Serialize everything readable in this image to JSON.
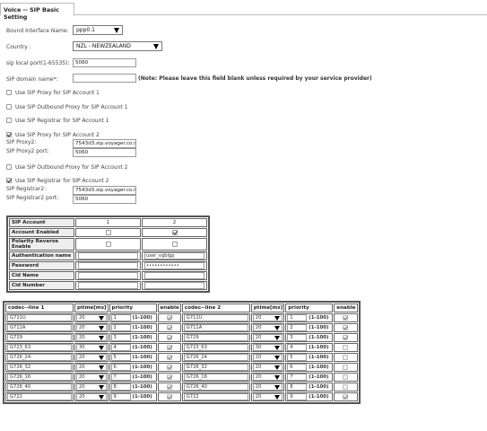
{
  "tab": {
    "label": "Voice -- SIP Basic Setting"
  },
  "form": {
    "bound_interface": {
      "label": "Bound Interface Name:",
      "value": "ppp0.1"
    },
    "country": {
      "label": "Country :",
      "value": "NZL - NEWZEALAND"
    },
    "sip_local_port": {
      "label": "sip local port(1-65535):",
      "value": "5060"
    },
    "sip_domain": {
      "label": "SIP domain name*:",
      "value": "",
      "note": "(Note: Please leave this field blank unless required by your service provider)"
    },
    "proxy1": {
      "label": "Use SIP Proxy for SIP Account 1",
      "checked": false
    },
    "outbound1": {
      "label": "Use SIP Outbound Proxy for SIP Account 1",
      "checked": false
    },
    "registrar1": {
      "label": "Use SIP Registrar for SIP Account 1",
      "checked": false
    },
    "proxy2": {
      "label": "Use SIP Proxy for SIP Account 2",
      "checked": true,
      "addr_label": "SIP Proxy2:",
      "addr": "7543d3.sip.voyager.co.nz",
      "port_label": "SIP Proxy2 port:",
      "port": "5060"
    },
    "outbound2": {
      "label": "Use SIP Outbound Proxy for SIP Account 2",
      "checked": false
    },
    "registrar2": {
      "label": "Use SIP Registrar for SIP Account 2",
      "checked": true,
      "addr_label": "SIP Registrar2:",
      "addr": "7543d3.sip.voyager.co.nz",
      "port_label": "SIP Registrar2 port:",
      "port": "5060"
    }
  },
  "accounts": {
    "header": "SIP Account",
    "col1": "1",
    "col2": "2",
    "rows": {
      "enabled": {
        "label": "Account Enabled",
        "v1": false,
        "v2": true
      },
      "polarity": {
        "label": "Polarity Reverse Enable",
        "v1": false,
        "v2": false
      },
      "auth": {
        "label": "Authentication name",
        "v1": "",
        "v2": "user_vgblgp"
      },
      "password": {
        "label": "Password",
        "v1": "",
        "v2": "••••••••••••"
      },
      "cid_name": {
        "label": "Cid Name",
        "v1": "",
        "v2": ""
      },
      "cid_number": {
        "label": "Cid Number",
        "v1": "",
        "v2": ""
      }
    }
  },
  "codecs": {
    "headers": {
      "codec1": "codec--line 1",
      "ptime": "ptime[ms]",
      "priority": "priority",
      "enable": "enable",
      "codec2": "codec--line 2"
    },
    "range": "(1-100)",
    "rows": [
      {
        "name": "G711U",
        "ptime": "20",
        "priority": "1",
        "en1": true,
        "en2": true
      },
      {
        "name": "G711A",
        "ptime": "20",
        "priority": "2",
        "en1": true,
        "en2": true
      },
      {
        "name": "G729",
        "ptime": "20",
        "priority": "3",
        "en1": true,
        "en2": true
      },
      {
        "name": "G723_63",
        "ptime": "30",
        "priority": "4",
        "en1": true,
        "en2": false
      },
      {
        "name": "G726_24",
        "ptime": "20",
        "priority": "5",
        "en1": true,
        "en2": false
      },
      {
        "name": "G726_32",
        "ptime": "20",
        "priority": "6",
        "en1": true,
        "en2": false
      },
      {
        "name": "G726_16",
        "ptime": "20",
        "priority": "7",
        "en1": true,
        "en2": false
      },
      {
        "name": "G726_40",
        "ptime": "20",
        "priority": "8",
        "en1": true,
        "en2": false
      },
      {
        "name": "G722",
        "ptime": "20",
        "priority": "9",
        "en1": true,
        "en2": true
      }
    ]
  }
}
